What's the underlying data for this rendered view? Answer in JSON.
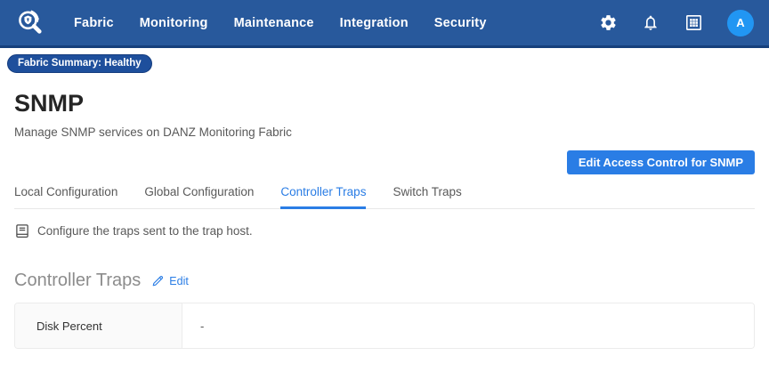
{
  "navbar": {
    "items": [
      "Fabric",
      "Monitoring",
      "Maintenance",
      "Integration",
      "Security"
    ],
    "avatar_letter": "A"
  },
  "status_badge": {
    "label": "Fabric Summary: Healthy"
  },
  "page": {
    "title": "SNMP",
    "subtitle": "Manage SNMP services on DANZ Monitoring Fabric"
  },
  "actions": {
    "edit_access_control": "Edit Access Control for SNMP"
  },
  "tabs": {
    "items": [
      {
        "label": "Local Configuration",
        "active": false
      },
      {
        "label": "Global Configuration",
        "active": false
      },
      {
        "label": "Controller Traps",
        "active": true
      },
      {
        "label": "Switch Traps",
        "active": false
      }
    ]
  },
  "info_note": {
    "text": "Configure the traps sent to the trap host."
  },
  "controller_traps_section": {
    "title": "Controller Traps",
    "edit_label": "Edit",
    "rows": [
      {
        "label": "Disk Percent",
        "value": "-"
      }
    ]
  },
  "colors": {
    "navbar_bg": "#28599c",
    "navbar_border": "#16407c",
    "accent_blue": "#2a7de5",
    "avatar_bg": "#2196f3",
    "badge_bg": "#1e4f9c"
  }
}
